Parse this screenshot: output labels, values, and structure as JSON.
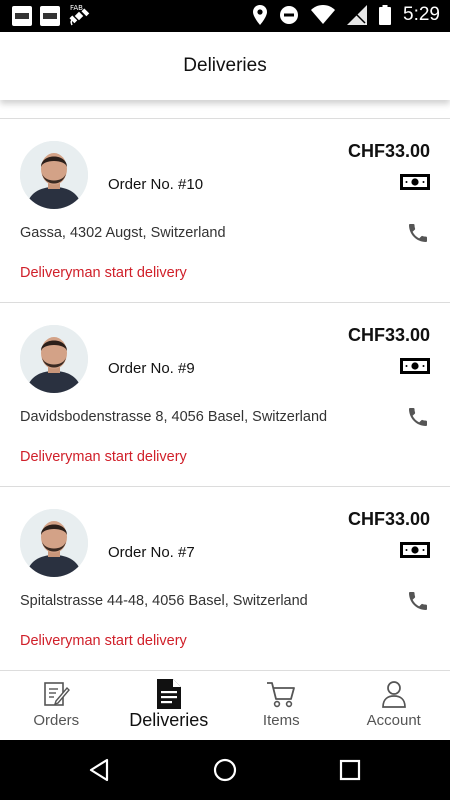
{
  "status_bar": {
    "time": "5:29",
    "left_icons": [
      "app-notification-icon",
      "app-notification-icon",
      "satellite-icon"
    ],
    "fab_label": "FAB",
    "right_icons": [
      "location-icon",
      "do-not-disturb-icon",
      "wifi-icon",
      "signal-icon",
      "battery-icon"
    ]
  },
  "header": {
    "title": "Deliveries"
  },
  "deliveries": [
    {
      "order_no": "Order No. #10",
      "price": "CHF33.00",
      "address": "Gassa, 4302 Augst, Switzerland",
      "status": "Deliveryman start delivery",
      "payment_icon": "cash-icon"
    },
    {
      "order_no": "Order No. #9",
      "price": "CHF33.00",
      "address": "Davidsbodenstrasse 8, 4056 Basel, Switzerland",
      "status": "Deliveryman start delivery",
      "payment_icon": "cash-icon"
    },
    {
      "order_no": "Order No. #7",
      "price": "CHF33.00",
      "address": "Spitalstrasse 44-48, 4056 Basel, Switzerland",
      "status": "Deliveryman start delivery",
      "payment_icon": "cash-icon"
    }
  ],
  "bottom_nav": {
    "active": "Deliveries",
    "items": [
      {
        "label": "Orders",
        "icon": "orders-icon"
      },
      {
        "label": "Deliveries",
        "icon": "document-icon"
      },
      {
        "label": "Items",
        "icon": "cart-icon"
      },
      {
        "label": "Account",
        "icon": "user-icon"
      }
    ]
  },
  "colors": {
    "status_red": "#d0202a",
    "status_bar": "#000000",
    "background": "#ffffff"
  }
}
